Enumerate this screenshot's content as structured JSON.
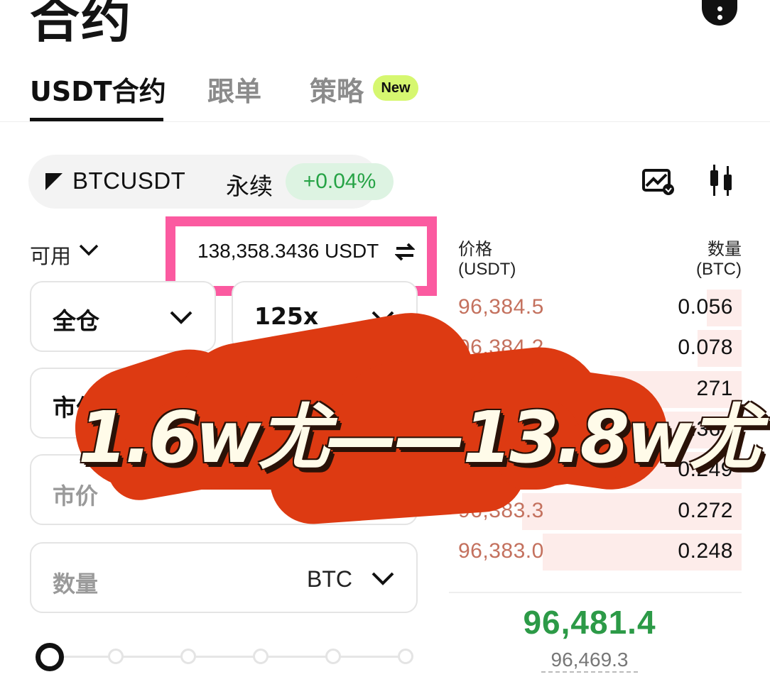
{
  "header": {
    "title": "合约"
  },
  "tabs": [
    {
      "label": "USDT合约",
      "active": true
    },
    {
      "label": "跟单"
    },
    {
      "label": "策略",
      "badge": "New"
    }
  ],
  "pair": {
    "symbol": "BTCUSDT",
    "type": "永续",
    "change": "+0.04%"
  },
  "available": {
    "label": "可用",
    "value": "138,358.3436 USDT"
  },
  "order_form": {
    "margin_mode": "全仓",
    "leverage": "125x",
    "order_type": "市价",
    "price_placeholder": "市价",
    "qty_placeholder": "数量",
    "qty_unit": "BTC",
    "slider_percent": 0
  },
  "orderbook": {
    "price_header": "价格",
    "price_unit": "(USDT)",
    "qty_header": "数量",
    "qty_unit": "(BTC)",
    "asks": [
      {
        "price": "96,384.5",
        "qty": "0.056",
        "depth": 0.12
      },
      {
        "price": "96,384.2",
        "qty": "0.078",
        "depth": 0.15
      },
      {
        "price": "",
        "qty": "271",
        "depth": 0.45
      },
      {
        "price": "",
        "qty": ".362",
        "depth": 0.55
      },
      {
        "price": "96",
        "qty": "0.249",
        "depth": 0.4
      },
      {
        "price": "96,383.3",
        "qty": "0.272",
        "depth": 0.75
      },
      {
        "price": "96,383.0",
        "qty": "0.248",
        "depth": 0.68
      }
    ],
    "last_price": "96,481.4",
    "mark_price": "96,469.3"
  },
  "overlay": {
    "text": "1.6w尤——13.8w尤"
  },
  "colors": {
    "up": "#2c9a47",
    "ask": "#c4715e",
    "highlight": "#fb5aa0",
    "overlay": "#dd3a12"
  }
}
